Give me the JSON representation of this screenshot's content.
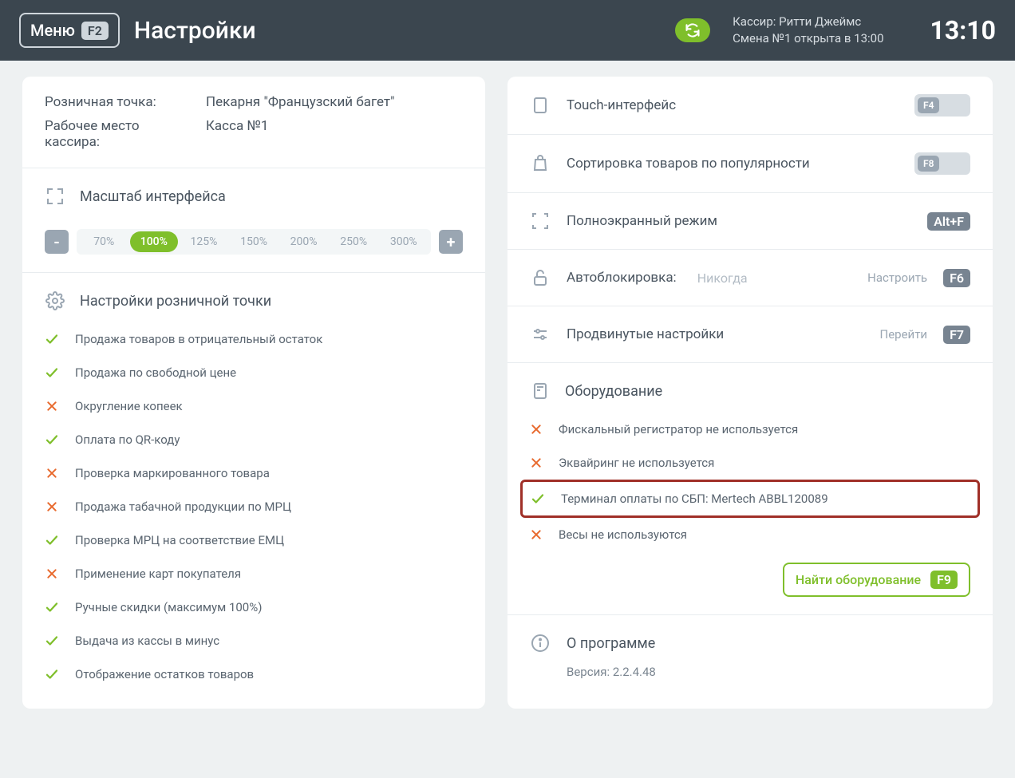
{
  "header": {
    "menu_label": "Меню",
    "menu_key": "F2",
    "title": "Настройки",
    "cashier_line": "Кассир: Ритти Джеймс",
    "shift_line": "Смена №1 открыта в 13:00",
    "clock": "13:10"
  },
  "info": {
    "store_label": "Розничная точка:",
    "store_value": "Пекарня \"Французский багет\"",
    "workplace_label": "Рабочее место кассира:",
    "workplace_value": "Касса №1"
  },
  "zoom": {
    "title": "Масштаб интерфейса",
    "minus": "-",
    "plus": "+",
    "steps": [
      "70%",
      "100%",
      "125%",
      "150%",
      "200%",
      "250%",
      "300%"
    ],
    "active_index": 1
  },
  "retail_settings": {
    "title": "Настройки розничной точки",
    "items": [
      {
        "ok": true,
        "label": "Продажа товаров в отрицательный остаток"
      },
      {
        "ok": true,
        "label": "Продажа по свободной цене"
      },
      {
        "ok": false,
        "label": "Округление копеек"
      },
      {
        "ok": true,
        "label": "Оплата по QR-коду"
      },
      {
        "ok": false,
        "label": "Проверка маркированного товара"
      },
      {
        "ok": false,
        "label": "Продажа табачной продукции по МРЦ"
      },
      {
        "ok": true,
        "label": "Проверка МРЦ на соответствие ЕМЦ"
      },
      {
        "ok": false,
        "label": "Применение карт покупателя"
      },
      {
        "ok": true,
        "label": "Ручные скидки (максимум 100%)"
      },
      {
        "ok": true,
        "label": "Выдача из кассы в минус"
      },
      {
        "ok": true,
        "label": "Отображение остатков товаров"
      }
    ]
  },
  "right": {
    "touch": {
      "label": "Touch-интерфейс",
      "key": "F4"
    },
    "sort": {
      "label": "Сортировка товаров по популярности",
      "key": "F8"
    },
    "fullscreen": {
      "label": "Полноэкранный режим",
      "key": "Alt+F"
    },
    "autolock": {
      "label": "Автоблокировка:",
      "value": "Никогда",
      "action": "Настроить",
      "key": "F6"
    },
    "advanced": {
      "label": "Продвинутые настройки",
      "action": "Перейти",
      "key": "F7"
    }
  },
  "equipment": {
    "title": "Оборудование",
    "items": [
      {
        "ok": false,
        "label": "Фискальный регистратор не используется",
        "hl": false
      },
      {
        "ok": false,
        "label": "Эквайринг не используется",
        "hl": false
      },
      {
        "ok": true,
        "label": "Терминал оплаты по СБП: Mertech ABBL120089",
        "hl": true
      },
      {
        "ok": false,
        "label": "Весы не используются",
        "hl": false
      }
    ],
    "find_label": "Найти оборудование",
    "find_key": "F9"
  },
  "about": {
    "title": "О программе",
    "version": "Версия: 2.2.4.48"
  }
}
